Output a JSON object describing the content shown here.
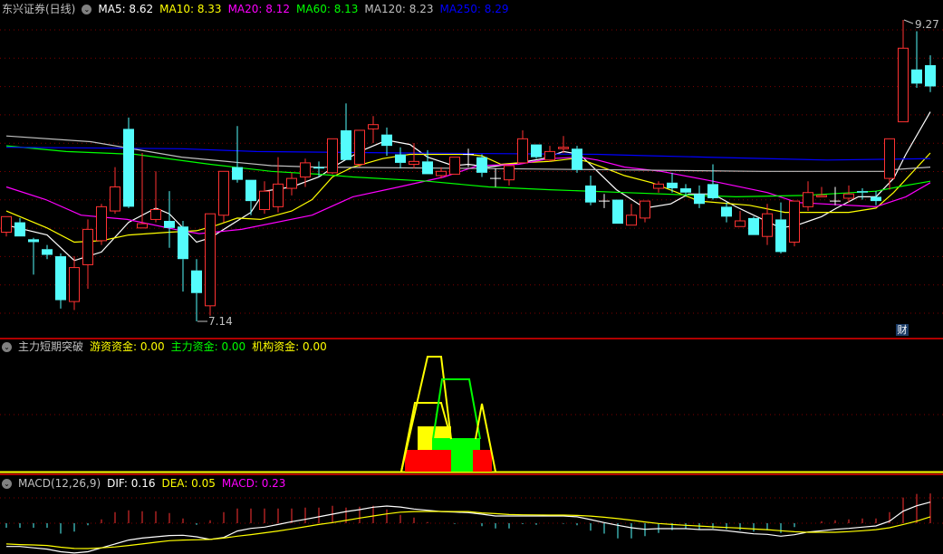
{
  "main": {
    "title": "东兴证券(日线)",
    "ma_labels": [
      {
        "text": "MA5: 8.62",
        "color": "#ffffff"
      },
      {
        "text": "MA10: 8.33",
        "color": "#ffff00"
      },
      {
        "text": "MA20: 8.12",
        "color": "#ff00ff"
      },
      {
        "text": "MA60: 8.13",
        "color": "#00ff00"
      },
      {
        "text": "MA120: 8.23",
        "color": "#c0c0c0"
      },
      {
        "text": "MA250: 8.29",
        "color": "#0000ff"
      }
    ],
    "high_label": "9.27",
    "low_label": "7.14",
    "finance_badge": "财"
  },
  "indicator": {
    "title": "主力短期突破",
    "labels": [
      {
        "text": "游资资金: 0.00",
        "color": "#ffff00"
      },
      {
        "text": "主力资金: 0.00",
        "color": "#00ff00"
      },
      {
        "text": "机构资金: 0.00",
        "color": "#ffff00"
      }
    ]
  },
  "macd": {
    "title": "MACD(12,26,9)",
    "labels": [
      {
        "text": "DIF: 0.16",
        "color": "#ffffff"
      },
      {
        "text": "DEA: 0.05",
        "color": "#ffff00"
      },
      {
        "text": "MACD: 0.23",
        "color": "#ff00ff"
      }
    ]
  },
  "colors": {
    "up": "#ff3232",
    "down": "#54fcfc",
    "grid": "#800000",
    "sep": "#b00000"
  },
  "chart_data": {
    "type": "candlestick",
    "price_range": [
      7.14,
      9.27
    ],
    "ohlc": [
      [
        7.77,
        7.88,
        7.88,
        7.74
      ],
      [
        7.84,
        7.74,
        7.87,
        7.74
      ],
      [
        7.72,
        7.7,
        7.73,
        7.47
      ],
      [
        7.65,
        7.61,
        7.68,
        7.58
      ],
      [
        7.6,
        7.29,
        7.62,
        7.23
      ],
      [
        7.28,
        7.52,
        7.6,
        7.22
      ],
      [
        7.54,
        7.79,
        7.86,
        7.37
      ],
      [
        7.71,
        7.95,
        7.97,
        7.68
      ],
      [
        7.92,
        8.09,
        8.23,
        7.9
      ],
      [
        8.5,
        7.95,
        8.58,
        7.94
      ],
      [
        7.8,
        7.83,
        8.33,
        7.8
      ],
      [
        7.86,
        7.93,
        8.2,
        7.84
      ],
      [
        7.85,
        7.8,
        8.06,
        7.66
      ],
      [
        7.81,
        7.58,
        7.85,
        7.35
      ],
      [
        7.5,
        7.34,
        7.58,
        7.14
      ],
      [
        7.25,
        7.9,
        7.9,
        7.18
      ],
      [
        7.89,
        8.2,
        8.2,
        7.84
      ],
      [
        8.23,
        8.14,
        8.52,
        8.12
      ],
      [
        8.14,
        7.99,
        8.14,
        7.89
      ],
      [
        7.93,
        8.06,
        8.13,
        7.9
      ],
      [
        7.95,
        8.11,
        8.3,
        7.91
      ],
      [
        8.08,
        8.15,
        8.19,
        8.03
      ],
      [
        8.16,
        8.26,
        8.29,
        8.09
      ],
      [
        8.23,
        8.22,
        8.27,
        8.16
      ],
      [
        8.19,
        8.43,
        8.43,
        8.18
      ],
      [
        8.49,
        8.28,
        8.68,
        8.28
      ],
      [
        8.25,
        8.49,
        8.49,
        8.23
      ],
      [
        8.5,
        8.53,
        8.59,
        8.4
      ],
      [
        8.46,
        8.38,
        8.51,
        8.31
      ],
      [
        8.32,
        8.26,
        8.37,
        8.22
      ],
      [
        8.25,
        8.27,
        8.4,
        8.22
      ],
      [
        8.27,
        8.18,
        8.35,
        8.18
      ],
      [
        8.17,
        8.2,
        8.23,
        8.15
      ],
      [
        8.18,
        8.3,
        8.3,
        8.18
      ],
      [
        8.32,
        8.32,
        8.36,
        8.23
      ],
      [
        8.3,
        8.19,
        8.32,
        8.16
      ],
      [
        8.15,
        8.15,
        8.22,
        8.09
      ],
      [
        8.14,
        8.24,
        8.24,
        8.1
      ],
      [
        8.26,
        8.43,
        8.49,
        8.26
      ],
      [
        8.39,
        8.3,
        8.39,
        8.29
      ],
      [
        8.28,
        8.34,
        8.38,
        8.27
      ],
      [
        8.36,
        8.37,
        8.45,
        8.33
      ],
      [
        8.36,
        8.21,
        8.38,
        8.19
      ],
      [
        8.1,
        7.98,
        8.17,
        7.96
      ],
      [
        7.99,
        7.99,
        8.04,
        7.94
      ],
      [
        8.0,
        7.83,
        8.0,
        7.83
      ],
      [
        7.82,
        7.89,
        7.97,
        7.82
      ],
      [
        7.87,
        7.99,
        7.99,
        7.84
      ],
      [
        8.08,
        8.11,
        8.13,
        8.05
      ],
      [
        8.12,
        8.08,
        8.19,
        8.05
      ],
      [
        8.08,
        8.05,
        8.11,
        8.02
      ],
      [
        8.04,
        7.97,
        8.1,
        7.94
      ],
      [
        8.11,
        8.01,
        8.25,
        8.0
      ],
      [
        7.95,
        7.88,
        7.98,
        7.84
      ],
      [
        7.81,
        7.85,
        7.92,
        7.81
      ],
      [
        7.87,
        7.75,
        7.88,
        7.75
      ],
      [
        7.74,
        7.9,
        7.97,
        7.68
      ],
      [
        7.86,
        7.63,
        7.98,
        7.62
      ],
      [
        7.7,
        7.99,
        7.99,
        7.67
      ],
      [
        7.95,
        8.05,
        8.13,
        7.92
      ],
      [
        8.02,
        8.03,
        8.09,
        8.02
      ],
      [
        7.99,
        7.99,
        8.09,
        7.96
      ],
      [
        8.01,
        8.04,
        8.1,
        7.98
      ],
      [
        8.06,
        8.05,
        8.08,
        8.0
      ],
      [
        8.02,
        7.99,
        8.06,
        7.96
      ],
      [
        8.15,
        8.43,
        8.43,
        8.07
      ],
      [
        8.55,
        9.07,
        9.27,
        8.55
      ],
      [
        8.92,
        8.82,
        9.19,
        8.79
      ],
      [
        8.95,
        8.8,
        9.02,
        8.76
      ]
    ],
    "ma_series": [
      {
        "name": "MA5",
        "color": "#ffffff",
        "points": [
          [
            0,
            7.82
          ],
          [
            3,
            7.75
          ],
          [
            5,
            7.57
          ],
          [
            7,
            7.63
          ],
          [
            9,
            7.84
          ],
          [
            11,
            7.94
          ],
          [
            12,
            7.9
          ],
          [
            14,
            7.7
          ],
          [
            15,
            7.73
          ],
          [
            18,
            7.91
          ],
          [
            19,
            8.06
          ],
          [
            21,
            8.09
          ],
          [
            23,
            8.16
          ],
          [
            24.4,
            8.25
          ],
          [
            26,
            8.34
          ],
          [
            28,
            8.42
          ],
          [
            29.7,
            8.39
          ],
          [
            31,
            8.3
          ],
          [
            32.9,
            8.24
          ],
          [
            34,
            8.25
          ],
          [
            35.5,
            8.23
          ],
          [
            37.7,
            8.26
          ],
          [
            39.5,
            8.29
          ],
          [
            41,
            8.34
          ],
          [
            42.2,
            8.32
          ],
          [
            43.5,
            8.2
          ],
          [
            44.9,
            8.07
          ],
          [
            47,
            7.94
          ],
          [
            48.9,
            7.97
          ],
          [
            50.2,
            8.04
          ],
          [
            52,
            8.04
          ],
          [
            53.7,
            7.95
          ],
          [
            55,
            7.89
          ],
          [
            57,
            7.8
          ],
          [
            58.2,
            7.82
          ],
          [
            60,
            7.88
          ],
          [
            61.1,
            7.94
          ],
          [
            62.7,
            8.02
          ],
          [
            64,
            8.02
          ],
          [
            65.3,
            8.15
          ],
          [
            66.2,
            8.32
          ],
          [
            68,
            8.62
          ]
        ]
      },
      {
        "name": "MA10",
        "color": "#ffff00",
        "points": [
          [
            0,
            7.92
          ],
          [
            3,
            7.8
          ],
          [
            5,
            7.7
          ],
          [
            7,
            7.71
          ],
          [
            9,
            7.75
          ],
          [
            12,
            7.77
          ],
          [
            14,
            7.78
          ],
          [
            15.5,
            7.82
          ],
          [
            17,
            7.87
          ],
          [
            18.7,
            7.86
          ],
          [
            21,
            7.92
          ],
          [
            22.5,
            8.0
          ],
          [
            24,
            8.16
          ],
          [
            25.5,
            8.23
          ],
          [
            27.7,
            8.29
          ],
          [
            29.7,
            8.32
          ],
          [
            32,
            8.32
          ],
          [
            34,
            8.32
          ],
          [
            35,
            8.31
          ],
          [
            36.4,
            8.25
          ],
          [
            37.7,
            8.26
          ],
          [
            40,
            8.27
          ],
          [
            41.7,
            8.29
          ],
          [
            42.7,
            8.27
          ],
          [
            44.4,
            8.21
          ],
          [
            45.5,
            8.17
          ],
          [
            47.5,
            8.12
          ],
          [
            51,
            7.99
          ],
          [
            54.7,
            7.96
          ],
          [
            57.3,
            7.91
          ],
          [
            62,
            7.91
          ],
          [
            64,
            7.94
          ],
          [
            65.3,
            8.05
          ],
          [
            68,
            8.33
          ]
        ]
      },
      {
        "name": "MA20",
        "color": "#ff00ff",
        "points": [
          [
            0,
            8.09
          ],
          [
            2.9,
            8.0
          ],
          [
            5.5,
            7.89
          ],
          [
            8.9,
            7.86
          ],
          [
            12.9,
            7.78
          ],
          [
            14.2,
            7.76
          ],
          [
            17.3,
            7.79
          ],
          [
            22.5,
            7.89
          ],
          [
            25.5,
            8.02
          ],
          [
            28.9,
            8.09
          ],
          [
            32.2,
            8.16
          ],
          [
            34.7,
            8.24
          ],
          [
            37.7,
            8.25
          ],
          [
            40,
            8.29
          ],
          [
            42.2,
            8.3
          ],
          [
            43.5,
            8.28
          ],
          [
            45.5,
            8.23
          ],
          [
            48.2,
            8.2
          ],
          [
            52,
            8.13
          ],
          [
            56,
            8.05
          ],
          [
            58.2,
            7.98
          ],
          [
            64,
            7.95
          ],
          [
            66.2,
            8.02
          ],
          [
            68,
            8.12
          ]
        ]
      },
      {
        "name": "MA60",
        "color": "#00ff00",
        "points": [
          [
            0,
            8.38
          ],
          [
            4.4,
            8.34
          ],
          [
            9.5,
            8.32
          ],
          [
            15,
            8.25
          ],
          [
            19.5,
            8.2
          ],
          [
            22.9,
            8.18
          ],
          [
            25.5,
            8.16
          ],
          [
            31,
            8.13
          ],
          [
            35.5,
            8.09
          ],
          [
            40,
            8.07
          ],
          [
            45.5,
            8.05
          ],
          [
            53.7,
            8.02
          ],
          [
            58.7,
            8.03
          ],
          [
            64,
            8.06
          ],
          [
            66.2,
            8.1
          ],
          [
            68,
            8.13
          ]
        ]
      },
      {
        "name": "MA120",
        "color": "#c0c0c0",
        "points": [
          [
            0,
            8.45
          ],
          [
            6.2,
            8.41
          ],
          [
            12.9,
            8.3
          ],
          [
            19.5,
            8.24
          ],
          [
            22.9,
            8.23
          ],
          [
            35.5,
            8.22
          ],
          [
            45.5,
            8.21
          ],
          [
            55.5,
            8.2
          ],
          [
            64.7,
            8.2
          ],
          [
            65,
            8.21
          ],
          [
            68,
            8.23
          ]
        ]
      },
      {
        "name": "MA250",
        "color": "#0000ff",
        "points": [
          [
            0,
            8.37
          ],
          [
            12.9,
            8.36
          ],
          [
            18.4,
            8.34
          ],
          [
            29.5,
            8.33
          ],
          [
            43.5,
            8.32
          ],
          [
            47.5,
            8.31
          ],
          [
            51.5,
            8.3
          ],
          [
            60.4,
            8.28
          ],
          [
            68,
            8.29
          ]
        ]
      }
    ],
    "macd_bars": [
      -0.035,
      -0.035,
      -0.035,
      -0.035,
      -0.08,
      -0.065,
      -0.016,
      0.03,
      0.086,
      0.1,
      0.093,
      0.093,
      0.079,
      0.037,
      -0.012,
      0.023,
      0.086,
      0.114,
      0.114,
      0.114,
      0.114,
      0.114,
      0.121,
      0.121,
      0.135,
      0.121,
      0.128,
      0.135,
      0.107,
      0.065,
      0.044,
      0.009,
      0,
      -0.005,
      0,
      -0.023,
      -0.04,
      -0.04,
      -0.007,
      -0.012,
      0,
      -0.004,
      -0.016,
      -0.058,
      -0.08,
      -0.117,
      -0.117,
      -0.1,
      -0.075,
      -0.054,
      -0.042,
      -0.047,
      -0.04,
      -0.047,
      -0.054,
      -0.065,
      -0.054,
      -0.075,
      -0.03,
      0,
      0.016,
      0.023,
      0.03,
      0.037,
      0.037,
      0.086,
      0.198,
      0.226,
      0.23
    ],
    "dif": [
      -0.18,
      -0.18,
      -0.19,
      -0.2,
      -0.22,
      -0.23,
      -0.22,
      -0.19,
      -0.16,
      -0.13,
      -0.115,
      -0.105,
      -0.095,
      -0.093,
      -0.105,
      -0.125,
      -0.11,
      -0.06,
      -0.04,
      -0.03,
      -0.01,
      0.012,
      0.03,
      0.05,
      0.07,
      0.09,
      0.105,
      0.124,
      0.133,
      0.125,
      0.11,
      0.1,
      0.09,
      0.086,
      0.082,
      0.07,
      0.056,
      0.056,
      0.056,
      0.056,
      0.056,
      0.056,
      0.05,
      0.028,
      0.005,
      -0.016,
      -0.035,
      -0.047,
      -0.042,
      -0.042,
      -0.042,
      -0.049,
      -0.049,
      -0.058,
      -0.07,
      -0.082,
      -0.086,
      -0.1,
      -0.089,
      -0.068,
      -0.058,
      -0.047,
      -0.04,
      -0.03,
      -0.021,
      0.016,
      0.093,
      0.135,
      0.163
    ],
    "dea": [
      -0.16,
      -0.165,
      -0.168,
      -0.172,
      -0.185,
      -0.195,
      -0.196,
      -0.19,
      -0.183,
      -0.172,
      -0.16,
      -0.147,
      -0.135,
      -0.13,
      -0.128,
      -0.125,
      -0.115,
      -0.1,
      -0.088,
      -0.074,
      -0.06,
      -0.044,
      -0.027,
      -0.01,
      0.005,
      0.022,
      0.04,
      0.056,
      0.072,
      0.085,
      0.09,
      0.091,
      0.091,
      0.09,
      0.09,
      0.08,
      0.074,
      0.067,
      0.065,
      0.064,
      0.063,
      0.063,
      0.06,
      0.055,
      0.046,
      0.036,
      0.024,
      0.01,
      -0.002,
      -0.01,
      -0.016,
      -0.022,
      -0.028,
      -0.033,
      -0.038,
      -0.045,
      -0.05,
      -0.058,
      -0.066,
      -0.07,
      -0.07,
      -0.07,
      -0.065,
      -0.058,
      -0.05,
      -0.035,
      -0.01,
      0.016,
      0.05
    ]
  }
}
